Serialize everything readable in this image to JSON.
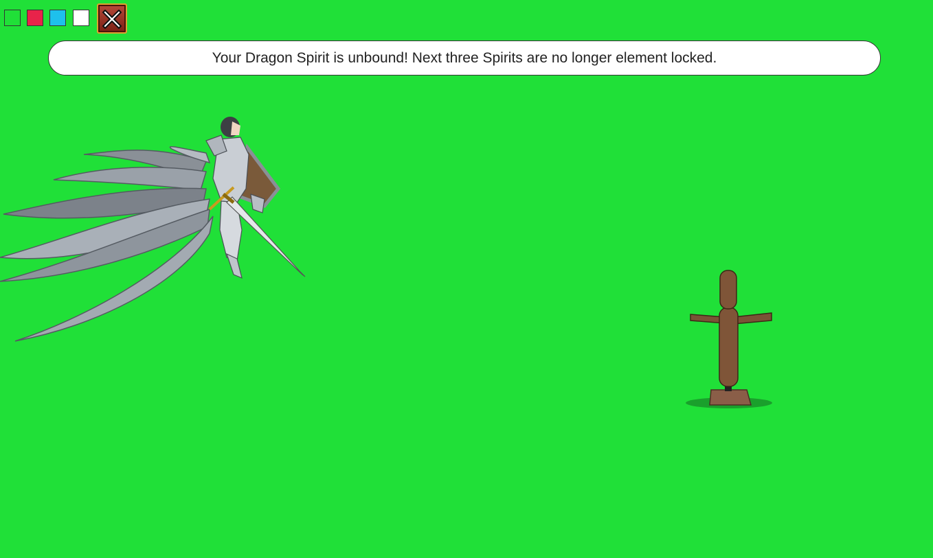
{
  "colors": {
    "background": "#20e038",
    "swatches": [
      "#20e038",
      "#e8234a",
      "#1ec0ec",
      "#ffffff"
    ]
  },
  "toolbar": {
    "swatches": [
      {
        "name": "green-swatch",
        "color": "#20e038"
      },
      {
        "name": "red-swatch",
        "color": "#e8234a"
      },
      {
        "name": "cyan-swatch",
        "color": "#1ec0ec"
      },
      {
        "name": "white-swatch",
        "color": "#ffffff"
      }
    ],
    "close_icon": "close-x-icon"
  },
  "message": {
    "text": "Your Dragon Spirit is unbound! Next three Spirits are no longer element locked."
  },
  "scene": {
    "hero": "armored-winged-knight",
    "target": "wooden-training-dummy"
  }
}
